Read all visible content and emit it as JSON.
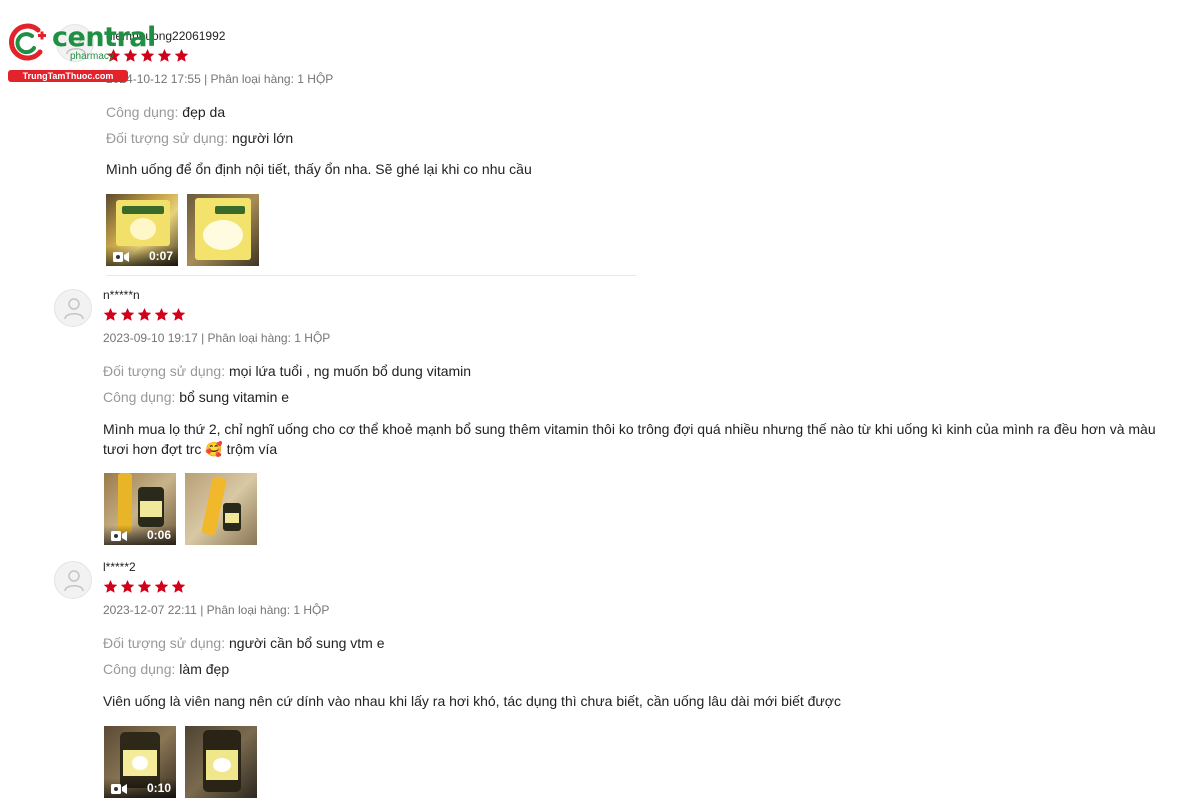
{
  "logo": {
    "name": "central",
    "sub": "pharmacy",
    "bar": "TrungTamThuoc.com"
  },
  "reviews": [
    {
      "username": "diemphuong22061992",
      "rating": 5,
      "meta": "2024-10-12 17:55 | Phân loại hàng: 1 HỘP",
      "attrs": [
        {
          "key": "Công dụng:",
          "value": "đẹp da"
        },
        {
          "key": "Đối tượng sử dụng:",
          "value": "người lớn"
        }
      ],
      "comment": "Mình uống để ổn định nội tiết, thấy ổn nha. Sẽ ghé lại khi co nhu cầu",
      "media": [
        {
          "type": "video",
          "duration": "0:07"
        },
        {
          "type": "image"
        }
      ]
    },
    {
      "username": "n*****n",
      "rating": 5,
      "meta": "2023-09-10 19:17 | Phân loại hàng: 1 HỘP",
      "attrs": [
        {
          "key": "Đối tượng sử dụng:",
          "value": "mọi lứa tuổi , ng muốn bổ dung vitamin"
        },
        {
          "key": "Công dụng:",
          "value": "bổ sung vitamin e"
        }
      ],
      "comment": "Mình mua lọ thứ 2, chỉ nghĩ uống cho cơ thể khoẻ mạnh bổ sung thêm vitamin thôi ko trông đợi quá nhiều nhưng  thế nào  từ khi uống kì kinh của mình ra đều hơn và màu tươi hơn đợt trc 🥰  trộm vía",
      "media": [
        {
          "type": "video",
          "duration": "0:06"
        },
        {
          "type": "image"
        }
      ]
    },
    {
      "username": "l*****2",
      "rating": 5,
      "meta": "2023-12-07 22:11 | Phân loại hàng: 1 HỘP",
      "attrs": [
        {
          "key": "Đối tượng sử dụng:",
          "value": "người cần bổ sung vtm e"
        },
        {
          "key": "Công dụng:",
          "value": "làm đẹp"
        }
      ],
      "comment": "Viên uống là viên nang nên cứ dính vào nhau khi lấy ra hơi khó, tác dụng thì chưa biết, cần uống lâu dài mới biết được",
      "media": [
        {
          "type": "video",
          "duration": "0:10"
        },
        {
          "type": "image"
        }
      ]
    }
  ],
  "colors": {
    "star": "#d0011b",
    "brand_green": "#1f8f44",
    "brand_red": "#e2232c"
  }
}
